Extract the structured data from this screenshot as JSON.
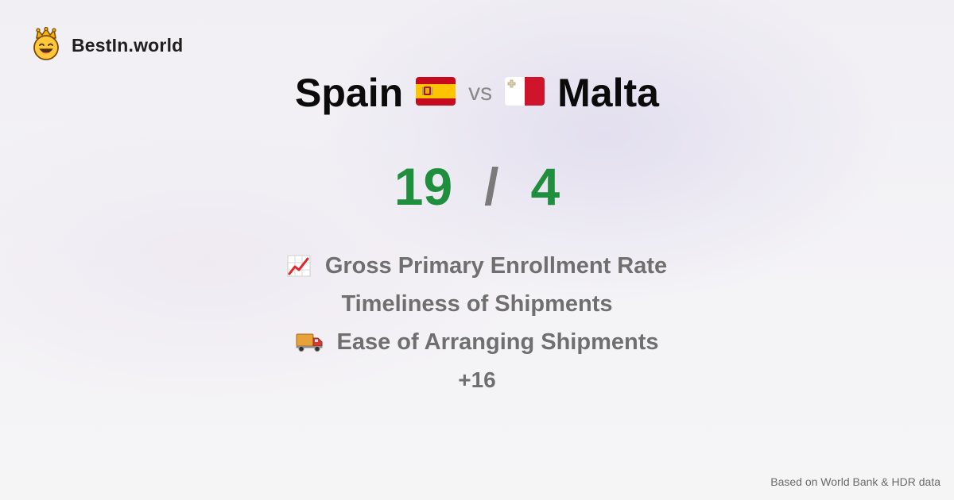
{
  "brand": {
    "name": "BestIn.world",
    "icon": "smiling-crown-face-icon"
  },
  "comparison": {
    "left": {
      "country": "Spain",
      "flag": "spain-flag-icon"
    },
    "vs_label": "vs",
    "right": {
      "country": "Malta",
      "flag": "malta-flag-icon"
    }
  },
  "score": {
    "left": "19",
    "separator": "/",
    "right": "4"
  },
  "metrics": [
    {
      "label": "Gross Primary Enrollment Rate",
      "icon": "chart-increasing-icon"
    },
    {
      "label": "Timeliness of Shipments",
      "icon": ""
    },
    {
      "label": "Ease of Arranging Shipments",
      "icon": "delivery-truck-icon"
    }
  ],
  "more": "+16",
  "footer": "Based on World Bank & HDR data",
  "colors": {
    "score": "#1f8f3e",
    "muted": "#6f6f6f",
    "title": "#0b0b0b"
  }
}
